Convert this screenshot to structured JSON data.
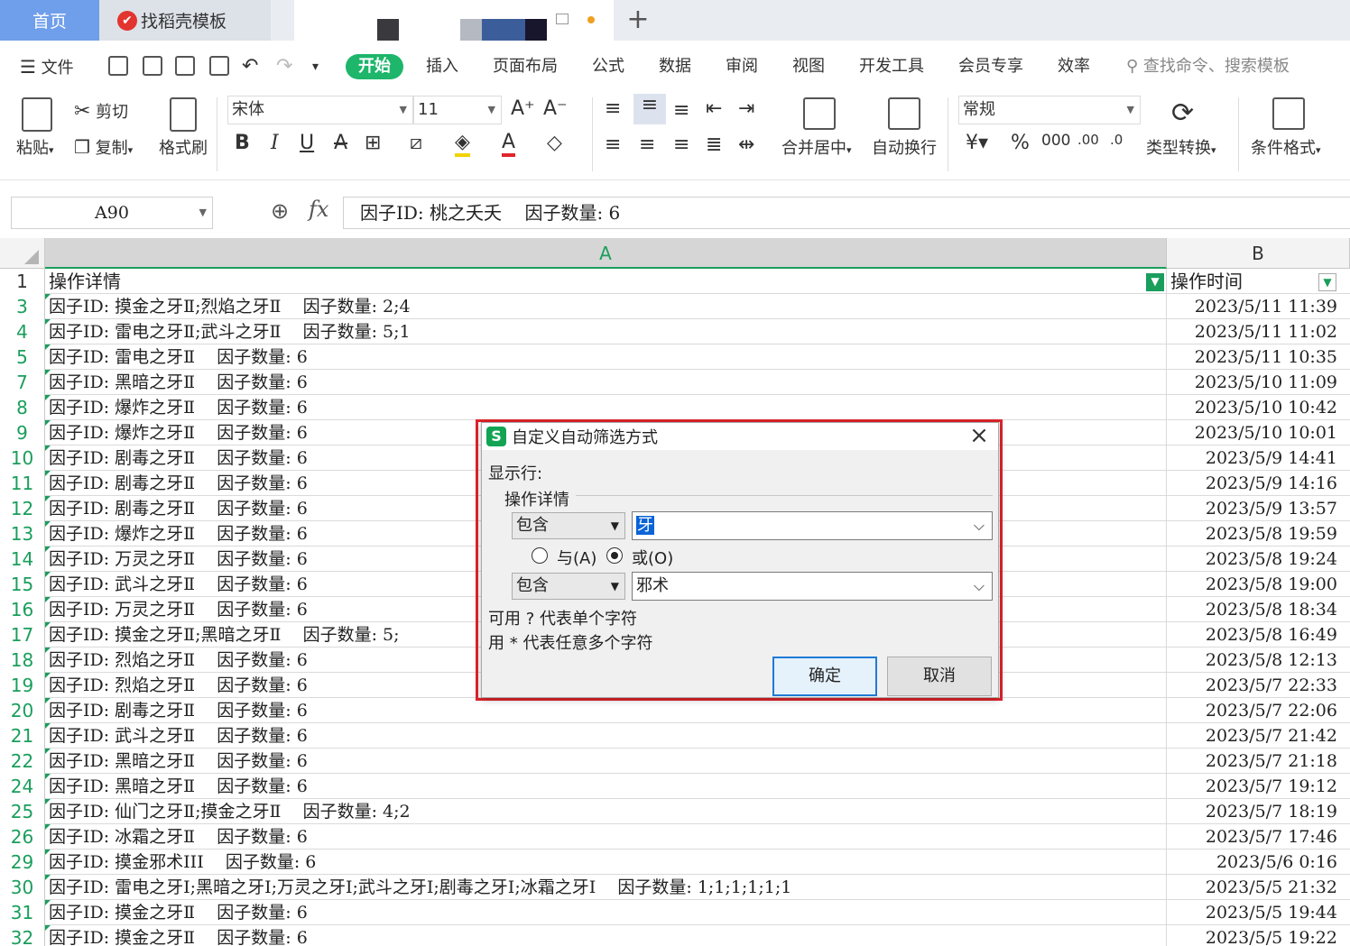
{
  "tabs": {
    "home": "首页",
    "daoke": "找稻壳模板",
    "add": "+"
  },
  "menubar": {
    "file": "文件",
    "items": [
      "开始",
      "插入",
      "页面布局",
      "公式",
      "数据",
      "审阅",
      "视图",
      "开发工具",
      "会员专享",
      "效率"
    ],
    "search_placeholder": "查找命令、搜索模板"
  },
  "ribbon": {
    "paste": "粘贴",
    "cut": "剪切",
    "copy": "复制",
    "format_painter": "格式刷",
    "font_name": "宋体",
    "font_size": "11",
    "merge_center": "合并居中",
    "wrap_text": "自动换行",
    "number_format": "常规",
    "type_convert": "类型转换",
    "conditional_format": "条件格式"
  },
  "formula_bar": {
    "cell_ref": "A90",
    "fx": "fx",
    "content": "因子ID: 桃之夭夭    因子数量: 6"
  },
  "grid": {
    "col_a": "A",
    "col_b": "B",
    "header_row": {
      "num": "1",
      "a": "操作详情",
      "b": "操作时间"
    },
    "rows": [
      {
        "num": "3",
        "a": "因子ID: 摸金之牙Ⅱ;烈焰之牙Ⅱ    因子数量: 2;4",
        "b": "2023/5/11 11:39"
      },
      {
        "num": "4",
        "a": "因子ID: 雷电之牙Ⅱ;武斗之牙Ⅱ    因子数量: 5;1",
        "b": "2023/5/11 11:02"
      },
      {
        "num": "5",
        "a": "因子ID: 雷电之牙Ⅱ    因子数量: 6",
        "b": "2023/5/11 10:35"
      },
      {
        "num": "7",
        "a": "因子ID: 黑暗之牙Ⅱ    因子数量: 6",
        "b": "2023/5/10 11:09"
      },
      {
        "num": "8",
        "a": "因子ID: 爆炸之牙Ⅱ    因子数量: 6",
        "b": "2023/5/10 10:42"
      },
      {
        "num": "9",
        "a": "因子ID: 爆炸之牙Ⅱ    因子数量: 6",
        "b": "2023/5/10 10:01"
      },
      {
        "num": "10",
        "a": "因子ID: 剧毒之牙Ⅱ    因子数量: 6",
        "b": "2023/5/9 14:41"
      },
      {
        "num": "11",
        "a": "因子ID: 剧毒之牙Ⅱ    因子数量: 6",
        "b": "2023/5/9 14:16"
      },
      {
        "num": "12",
        "a": "因子ID: 剧毒之牙Ⅱ    因子数量: 6",
        "b": "2023/5/9 13:57"
      },
      {
        "num": "13",
        "a": "因子ID: 爆炸之牙Ⅱ    因子数量: 6",
        "b": "2023/5/8 19:59"
      },
      {
        "num": "14",
        "a": "因子ID: 万灵之牙Ⅱ    因子数量: 6",
        "b": "2023/5/8 19:24"
      },
      {
        "num": "15",
        "a": "因子ID: 武斗之牙Ⅱ    因子数量: 6",
        "b": "2023/5/8 19:00"
      },
      {
        "num": "16",
        "a": "因子ID: 万灵之牙Ⅱ    因子数量: 6",
        "b": "2023/5/8 18:34"
      },
      {
        "num": "17",
        "a": "因子ID: 摸金之牙Ⅱ;黑暗之牙Ⅱ    因子数量: 5;",
        "b": "2023/5/8 16:49"
      },
      {
        "num": "18",
        "a": "因子ID: 烈焰之牙Ⅱ    因子数量: 6",
        "b": "2023/5/8 12:13"
      },
      {
        "num": "19",
        "a": "因子ID: 烈焰之牙Ⅱ    因子数量: 6",
        "b": "2023/5/7 22:33"
      },
      {
        "num": "20",
        "a": "因子ID: 剧毒之牙Ⅱ    因子数量: 6",
        "b": "2023/5/7 22:06"
      },
      {
        "num": "21",
        "a": "因子ID: 武斗之牙Ⅱ    因子数量: 6",
        "b": "2023/5/7 21:42"
      },
      {
        "num": "22",
        "a": "因子ID: 黑暗之牙Ⅱ    因子数量: 6",
        "b": "2023/5/7 21:18"
      },
      {
        "num": "24",
        "a": "因子ID: 黑暗之牙Ⅱ    因子数量: 6",
        "b": "2023/5/7 19:12"
      },
      {
        "num": "25",
        "a": "因子ID: 仙门之牙Ⅱ;摸金之牙Ⅱ    因子数量: 4;2",
        "b": "2023/5/7 18:19"
      },
      {
        "num": "26",
        "a": "因子ID: 冰霜之牙Ⅱ    因子数量: 6",
        "b": "2023/5/7 17:46"
      },
      {
        "num": "29",
        "a": "因子ID: 摸金邪术III    因子数量: 6",
        "b": "2023/5/6 0:16"
      },
      {
        "num": "30",
        "a": "因子ID: 雷电之牙Ⅰ;黑暗之牙Ⅰ;万灵之牙Ⅰ;武斗之牙Ⅰ;剧毒之牙Ⅰ;冰霜之牙Ⅰ    因子数量: 1;1;1;1;1;1",
        "b": "2023/5/5 21:32"
      },
      {
        "num": "31",
        "a": "因子ID: 摸金之牙Ⅱ    因子数量: 6",
        "b": "2023/5/5 19:44"
      },
      {
        "num": "32",
        "a": "因子ID: 摸金之牙Ⅱ    因子数量: 6",
        "b": "2023/5/5 19:22"
      }
    ]
  },
  "dialog": {
    "logo": "S",
    "title": "自定义自动筛选方式",
    "show_rows": "显示行:",
    "field": "操作详情",
    "op1": "包含",
    "value1": "牙",
    "and_label": "与(A)",
    "or_label": "或(O)",
    "op2": "包含",
    "value2": "邪术",
    "hint1": "可用 ? 代表单个字符",
    "hint2": "用 * 代表任意多个字符",
    "ok": "确定",
    "cancel": "取消"
  }
}
